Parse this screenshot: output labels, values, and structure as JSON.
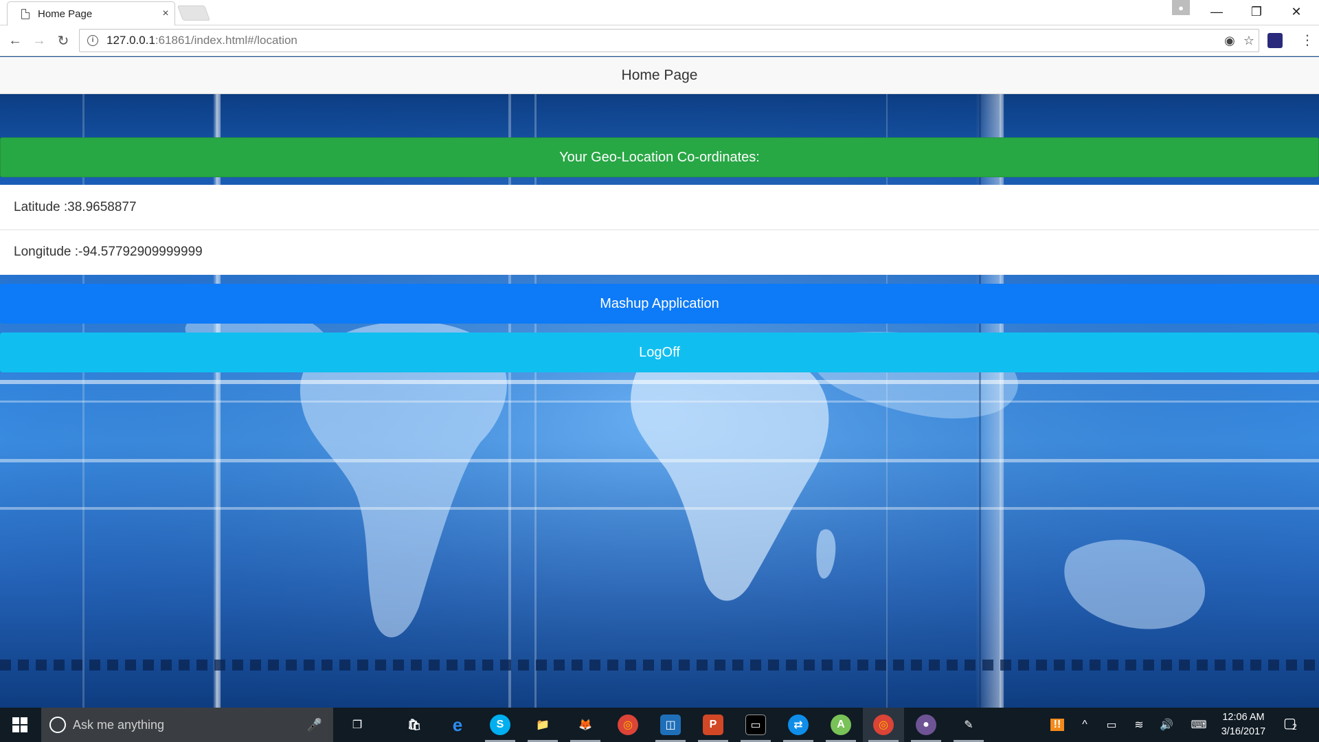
{
  "browser": {
    "tab_title": "Home Page",
    "tab_close": "×",
    "url_host": "127.0.0.1",
    "url_rest": ":61861/index.html#/location",
    "back_icon": "←",
    "forward_icon": "→",
    "reload_icon": "↻",
    "location_icon": "◉",
    "star_icon": "☆",
    "menu_icon": "⋮",
    "minimize_icon": "—",
    "restore_icon": "❐",
    "close_icon": "✕"
  },
  "page": {
    "header_title": "Home Page",
    "geo_banner": "Your Geo-Location Co-ordinates:",
    "latitude_text": "Latitude :38.9658877",
    "longitude_text": "Longitude :-94.57792909999999",
    "mashup_button": "Mashup Application",
    "logoff_button": "LogOff"
  },
  "taskbar": {
    "search_placeholder": "Ask me anything",
    "mic_icon": "🎤",
    "time": "12:06 AM",
    "date": "3/16/2017",
    "notification_count": "2",
    "apps": [
      {
        "name": "task-view-icon",
        "label": "❐"
      },
      {
        "name": "store-icon",
        "label": "🛍"
      },
      {
        "name": "edge-icon",
        "label": "e"
      },
      {
        "name": "skype-icon",
        "label": "S"
      },
      {
        "name": "file-explorer-icon",
        "label": "📁"
      },
      {
        "name": "firefox-icon",
        "label": "🦊"
      },
      {
        "name": "chrome-icon",
        "label": "◎"
      },
      {
        "name": "app-icon",
        "label": "◫"
      },
      {
        "name": "powerpoint-icon",
        "label": "P"
      },
      {
        "name": "cmd-icon",
        "label": "▭"
      },
      {
        "name": "teamviewer-icon",
        "label": "⇄"
      },
      {
        "name": "android-studio-icon",
        "label": "A"
      },
      {
        "name": "chrome-active-icon",
        "label": "◎"
      },
      {
        "name": "github-icon",
        "label": "●"
      },
      {
        "name": "paint-icon",
        "label": "✎"
      }
    ],
    "colors": {
      "banner": "#28a745",
      "mashup": "#0d7af7",
      "logoff": "#10bff0"
    }
  }
}
